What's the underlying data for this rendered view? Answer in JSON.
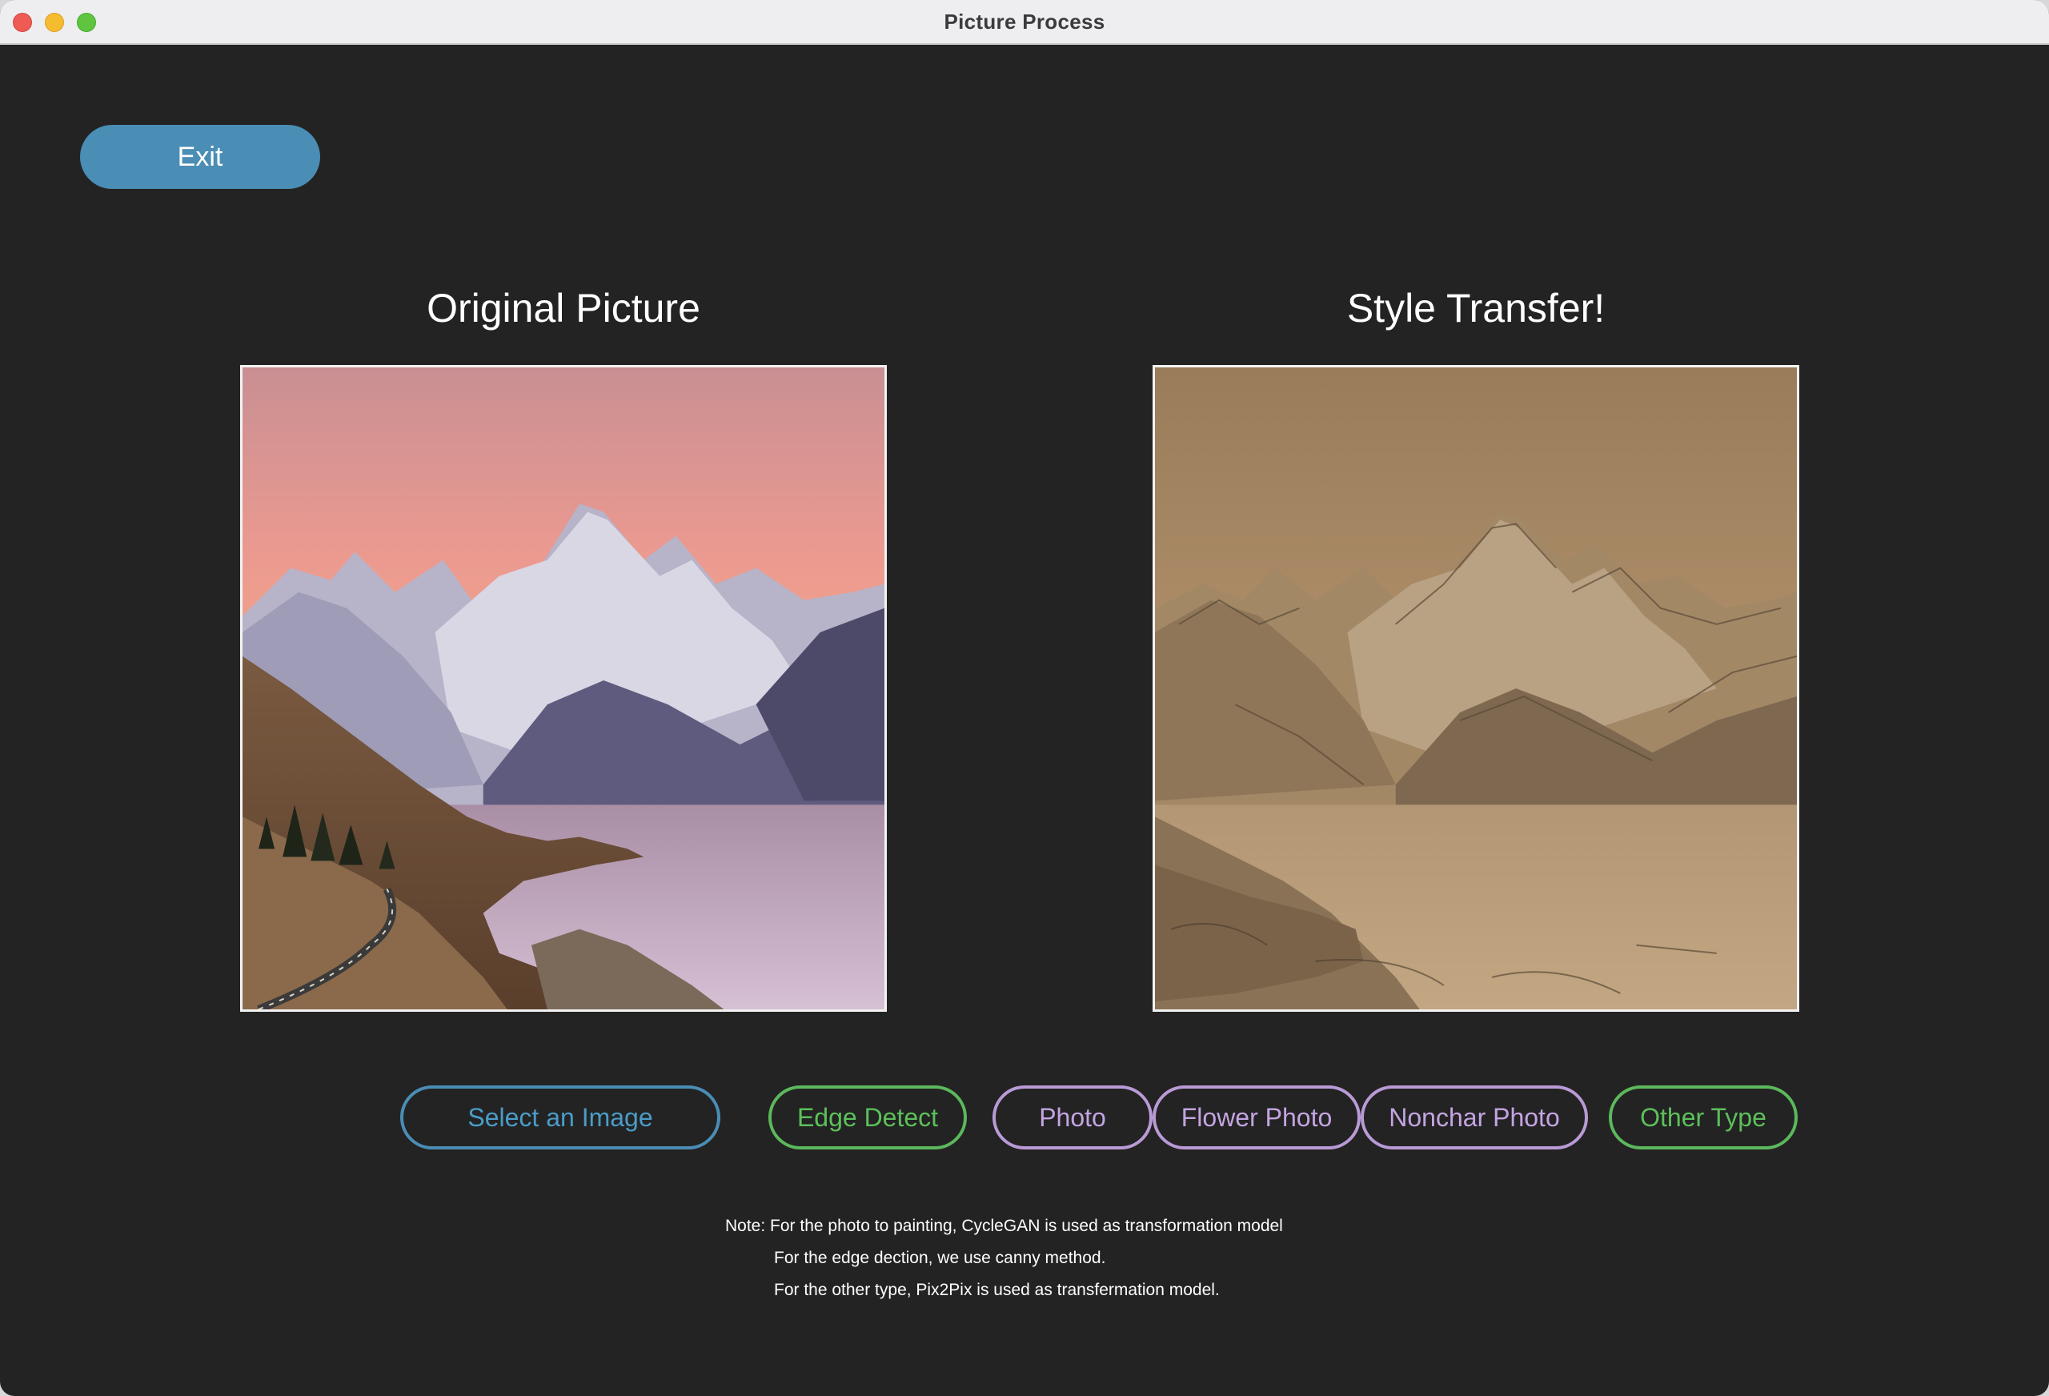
{
  "window": {
    "title": "Picture Process"
  },
  "toolbar": {
    "exit_label": "Exit"
  },
  "panels": {
    "original_title": "Original Picture",
    "result_title": "Style Transfer!"
  },
  "actions": {
    "select_image": "Select an Image",
    "edge_detect": "Edge Detect",
    "photo": "Photo",
    "flower_photo": "Flower Photo",
    "nonchar_photo": "Nonchar Photo",
    "other_type": "Other Type"
  },
  "notes": {
    "line1": "Note: For the photo to painting, CycleGAN is used as transformation model",
    "line2": "For the edge dection, we use canny method.",
    "line3": "For the other type, Pix2Pix is used as transfermation model."
  },
  "colors": {
    "background": "#232323",
    "accent_blue": "#4a8db5",
    "accent_green": "#5cb85c",
    "accent_purple": "#b99ad6"
  },
  "icons": {
    "close": "close-dot-icon",
    "minimize": "minimize-dot-icon",
    "zoom": "zoom-dot-icon"
  }
}
